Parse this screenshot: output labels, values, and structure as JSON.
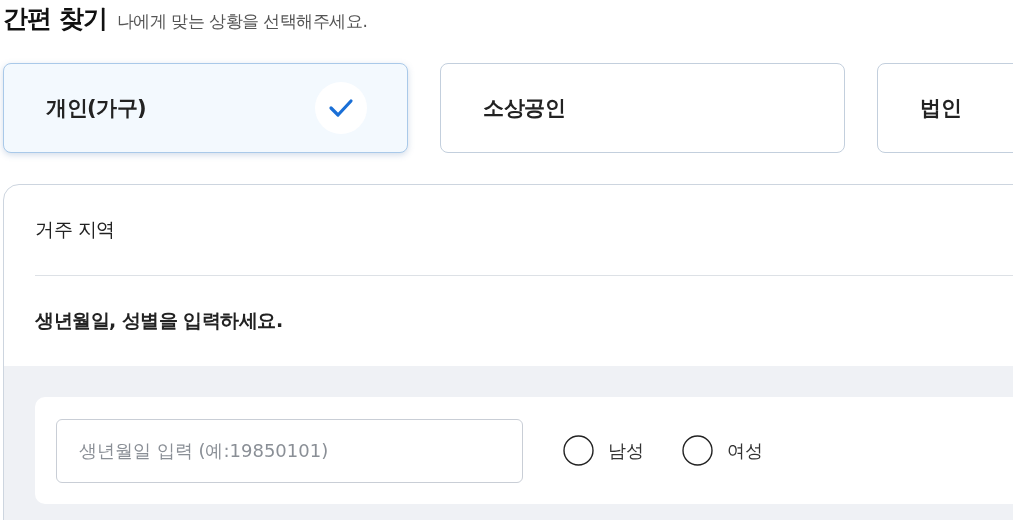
{
  "header": {
    "title": "간편 찾기",
    "subtitle": "나에게 맞는 상황을 선택해주세요."
  },
  "categories": [
    {
      "label": "개인(가구)",
      "selected": true
    },
    {
      "label": "소상공인",
      "selected": false
    },
    {
      "label": "법인",
      "selected": false
    }
  ],
  "form": {
    "region_label": "거주 지역",
    "prompt": "생년월일, 성별을 입력하세요.",
    "birthdate": {
      "placeholder": "생년월일 입력 (예:19850101)"
    },
    "genders": [
      {
        "label": "남성",
        "selected": false
      },
      {
        "label": "여성",
        "selected": false
      }
    ]
  }
}
